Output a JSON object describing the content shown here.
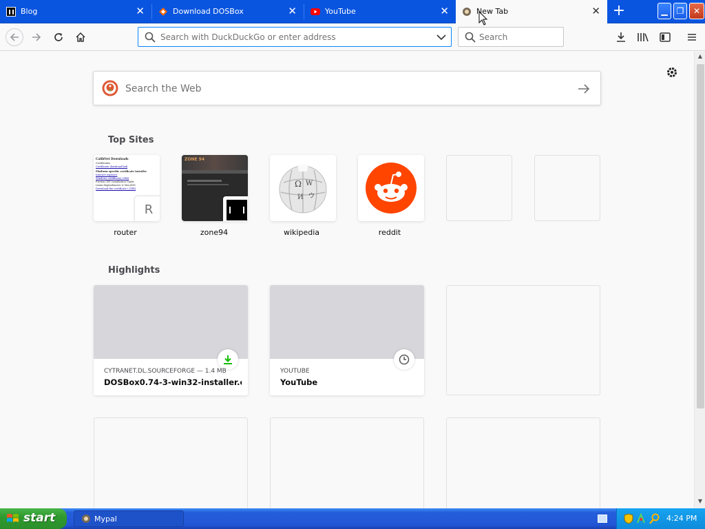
{
  "tabs": [
    {
      "title": "Blog",
      "favicon": "blog-favicon"
    },
    {
      "title": "Download DOSBox",
      "favicon": "sourceforge-favicon"
    },
    {
      "title": "YouTube",
      "favicon": "youtube-favicon"
    },
    {
      "title": "New Tab",
      "favicon": "firefox-favicon",
      "active": true
    }
  ],
  "navbar": {
    "url_placeholder": "Search with DuckDuckGo or enter address",
    "search_placeholder": "Search"
  },
  "newtab": {
    "web_search_placeholder": "Search the Web",
    "top_sites_title": "Top Sites",
    "top_sites": [
      {
        "label": "router",
        "letter": "R"
      },
      {
        "label": "zone94"
      },
      {
        "label": "wikipedia"
      },
      {
        "label": "reddit"
      },
      {
        "label": ""
      },
      {
        "label": ""
      }
    ],
    "highlights_title": "Highlights",
    "highlights": [
      {
        "source": "CYTRANET.DL.SOURCEFORGE — 1.4 MB",
        "title": "DOSBox0.74-3-win32-installer.e...",
        "badge": "download-icon"
      },
      {
        "source": "YOUTUBE",
        "title": "YouTube",
        "badge": "clock-icon"
      }
    ],
    "router_thumb": {
      "heading": "CalibNet Downloads",
      "lines": [
        "Certificates",
        "Certificate download link",
        "Platform specific certificate installer",
        "Internet explorer",
        "Windows certificate(.CER)",
        "Firefox CRT Installation Guide",
        "Linux dependencies & Mac/IOS",
        "Download the certificate (.CER)"
      ]
    },
    "zone94_thumb_title": "ZONE 94"
  },
  "taskbar": {
    "start_label": "start",
    "task_label": "Mypal",
    "clock": "4:24 PM"
  },
  "colors": {
    "titlebar": "#0a55e0",
    "accent": "#0a84ff",
    "reddit": "#ff4500",
    "download_green": "#12bc00"
  }
}
